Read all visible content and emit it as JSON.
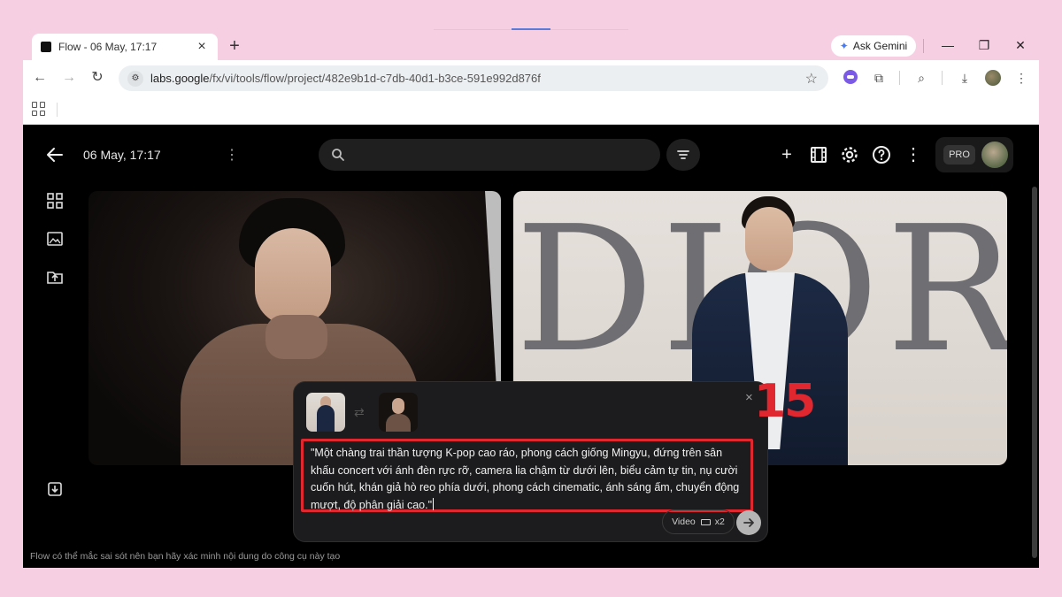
{
  "browser": {
    "tab_title": "Flow - 06 May, 17:17",
    "tab_close": "×",
    "new_tab": "+",
    "gemini_label": "Ask Gemini",
    "url_host": "labs.google",
    "url_path": "/fx/vi/tools/flow/project/482e9b1d-c7db-40d1-b3ce-591e992d876f"
  },
  "app": {
    "project_title": "06 May, 17:17",
    "search_placeholder": "",
    "pro_badge": "PRO",
    "disclaimer": "Flow có thể mắc sai sót nên bạn hãy xác minh nội dung do công cụ này tạo"
  },
  "media": {
    "right_card_text": "DIOR"
  },
  "prompt": {
    "text": "\"Một chàng trai thần tượng K-pop cao ráo, phong cách giống Mingyu, đứng trên sân khấu concert với ánh đèn rực rỡ, camera lia chậm từ dưới lên, biểu cảm tự tin, nụ cười cuốn hút, khán giả hò reo phía dưới, phong cách cinematic, ánh sáng ấm, chuyển động mượt, độ phân giải cao.\"",
    "mode_label": "Video",
    "count_label": "x2",
    "close": "×"
  },
  "annotation": {
    "step_number": "15"
  },
  "colors": {
    "page_background": "#f7cfe3",
    "app_background": "#000000",
    "highlight_red": "#e0262f",
    "gemini_accent": "#4a7cf0"
  }
}
